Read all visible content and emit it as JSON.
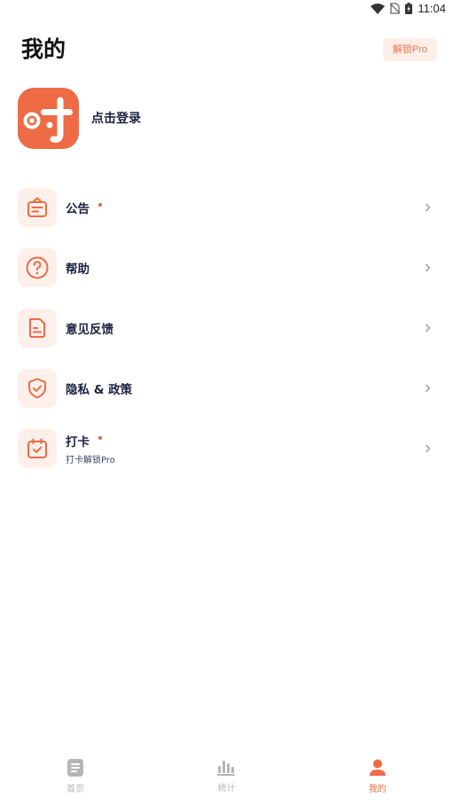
{
  "status_bar": {
    "time": "11:04"
  },
  "header": {
    "title": "我的",
    "unlock_label": "解锁Pro"
  },
  "profile": {
    "login_label": "点击登录"
  },
  "menu": {
    "items": [
      {
        "label": "公告",
        "icon": "announcement-icon",
        "has_dot": true
      },
      {
        "label": "帮助",
        "icon": "help-icon",
        "has_dot": false
      },
      {
        "label": "意见反馈",
        "icon": "feedback-icon",
        "has_dot": false
      },
      {
        "label": "隐私 & 政策",
        "icon": "privacy-shield-icon",
        "has_dot": false
      },
      {
        "label": "打卡",
        "sub": "打卡解锁Pro",
        "icon": "checkin-calendar-icon",
        "has_dot": true
      }
    ]
  },
  "bottom_nav": {
    "items": [
      {
        "label": "首页",
        "icon": "home-list-icon",
        "active": false
      },
      {
        "label": "统计",
        "icon": "stats-chart-icon",
        "active": false
      },
      {
        "label": "我的",
        "icon": "profile-user-icon",
        "active": true
      }
    ]
  },
  "colors": {
    "accent": "#ee6b45",
    "accent_light": "#fdf0eb",
    "text_dark": "#1b2240",
    "nav_inactive": "#b5b5b5"
  }
}
